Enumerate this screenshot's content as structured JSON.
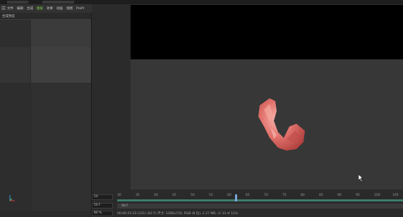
{
  "menu": {
    "items": [
      {
        "label": "文件"
      },
      {
        "label": "编辑"
      },
      {
        "label": "合成"
      },
      {
        "label": "图层"
      },
      {
        "label": "效果"
      },
      {
        "label": "动画"
      },
      {
        "label": "视图"
      },
      {
        "label": "ProPr"
      }
    ],
    "active_index": 3
  },
  "left_panel": {
    "title": "合成预览"
  },
  "timeline": {
    "zoom_value": "50",
    "frame_value": "50 F",
    "percent_value": "80 %",
    "track_label": "50 F",
    "ruler_ticks": [
      "30",
      "35",
      "40",
      "45",
      "50",
      "55",
      "60",
      "65",
      "70",
      "75",
      "80",
      "85",
      "90",
      "95",
      "100",
      "105"
    ],
    "current_frame": 63,
    "status": "00:00:25:33 (121) (62 F)   尺寸: 1280x720, RGB (8 位), 2.27 MB, (1 33 of 121)"
  },
  "colors": {
    "accent_green": "#8bd64a",
    "timeline_green": "#3e7c6e",
    "playhead_blue": "#7aa6d8",
    "object_pink": "#e0706a"
  }
}
